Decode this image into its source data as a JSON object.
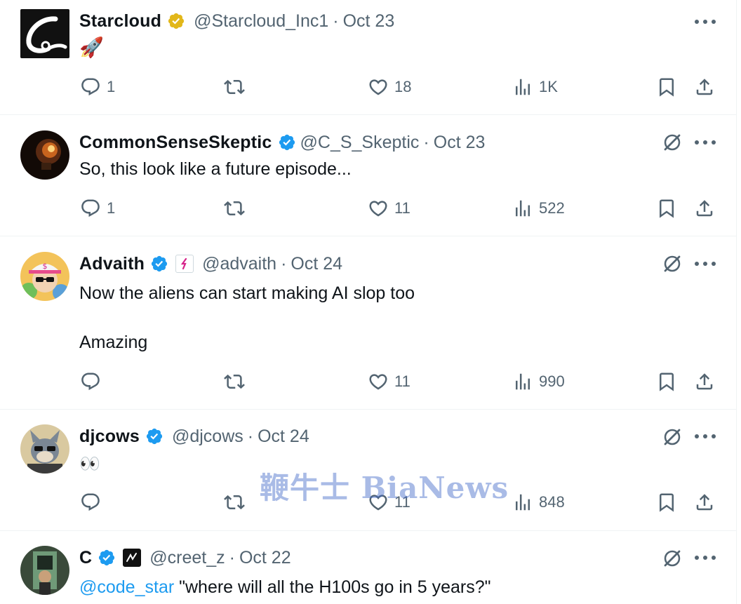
{
  "watermark": "鞭牛士 BiaNews",
  "tweets": [
    {
      "name": "Starcloud",
      "handle": "@Starcloud_Inc1",
      "dot": "·",
      "date": "Oct 23",
      "text": "🚀",
      "verified": "gold",
      "grok_icon": false,
      "actions": {
        "reply": "1",
        "retweet": "",
        "like": "18",
        "views": "1K"
      }
    },
    {
      "name": "CommonSenseSkeptic",
      "handle": "@C_S_Skeptic",
      "dot": "·",
      "date": "Oct 23",
      "text": "So, this look like a future episode...",
      "verified": "blue",
      "grok_icon": true,
      "actions": {
        "reply": "1",
        "retweet": "",
        "like": "11",
        "views": "522"
      }
    },
    {
      "name": "Advaith",
      "handle": "@advaith",
      "dot": "·",
      "date": "Oct 24",
      "text": "Now the aliens can start making AI slop too\n\nAmazing",
      "verified": "blue",
      "grok_icon": true,
      "actions": {
        "reply": "",
        "retweet": "",
        "like": "11",
        "views": "990"
      }
    },
    {
      "name": "djcows",
      "handle": "@djcows",
      "dot": "·",
      "date": "Oct 24",
      "text": "👀",
      "verified": "blue",
      "grok_icon": true,
      "actions": {
        "reply": "",
        "retweet": "",
        "like": "11",
        "views": "848"
      }
    },
    {
      "name": "C",
      "handle": "@creet_z",
      "dot": "·",
      "date": "Oct 22",
      "mention": "@code_star",
      "text": " \"where will all the H100s go in 5 years?\"",
      "verified": "blue",
      "grok_icon": true,
      "actions": {
        "reply": "",
        "retweet": "",
        "like": "",
        "views": ""
      }
    }
  ],
  "colors": {
    "text": "#0f1419",
    "muted": "#536471",
    "accent": "#1d9bf0",
    "gold": "#e2b719",
    "border": "#eff3f4"
  }
}
